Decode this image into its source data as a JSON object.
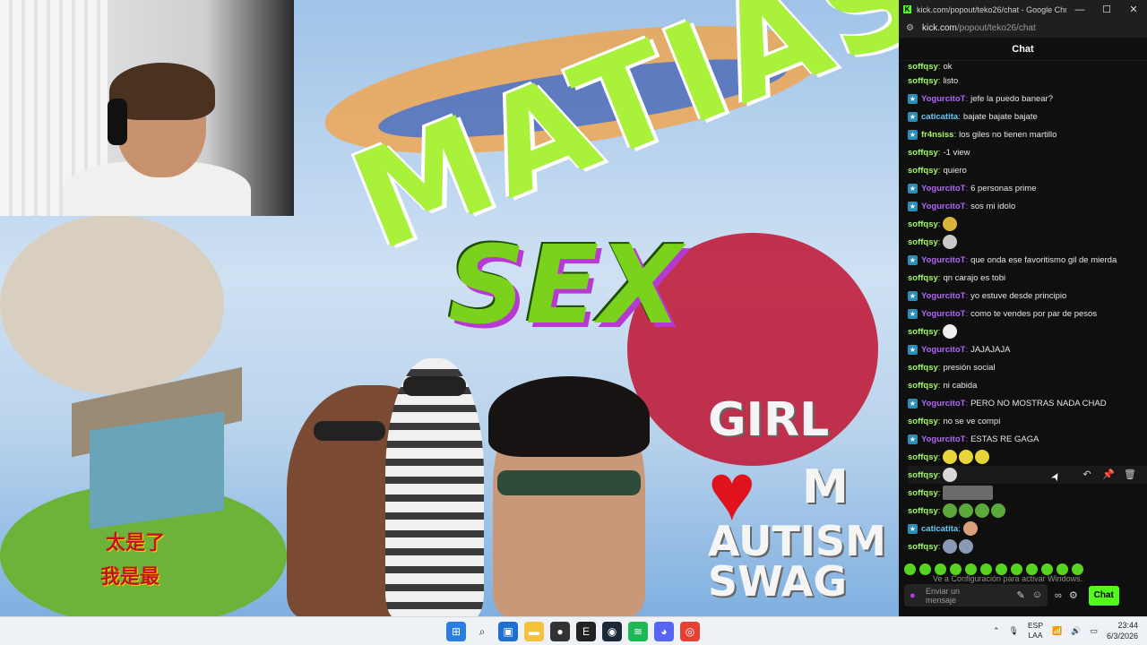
{
  "browser": {
    "title": "kick.com/popout/teko26/chat - Google Chro...",
    "url_host": "kick.com",
    "url_path": "/popout/teko26/chat",
    "minimize": "—",
    "maximize": "☐",
    "close": "✕"
  },
  "chat": {
    "header": "Chat",
    "messages": [
      {
        "user": "soffqsy",
        "color": "#a4f56b",
        "badge": false,
        "text": "ok"
      },
      {
        "user": "soffqsy",
        "color": "#a4f56b",
        "badge": false,
        "text": "listo"
      },
      {
        "user": "YogurcitoT",
        "color": "#b067f7",
        "badge": true,
        "text": "jefe la puedo banear?"
      },
      {
        "user": "caticatita",
        "color": "#69c9f7",
        "badge": true,
        "text": "bajate bajate bajate"
      },
      {
        "user": "fr4nsiss",
        "color": "#a4f56b",
        "badge": true,
        "text": "los giles no tienen martillo"
      },
      {
        "user": "soffqsy",
        "color": "#a4f56b",
        "badge": false,
        "text": "-1 view"
      },
      {
        "user": "soffqsy",
        "color": "#a4f56b",
        "badge": false,
        "text": "quiero"
      },
      {
        "user": "YogurcitoT",
        "color": "#b067f7",
        "badge": true,
        "text": "6 personas prime"
      },
      {
        "user": "YogurcitoT",
        "color": "#b067f7",
        "badge": true,
        "text": "sos mi idolo"
      },
      {
        "user": "soffqsy",
        "color": "#a4f56b",
        "badge": false,
        "text": "",
        "emotes": [
          "#d9b23a"
        ]
      },
      {
        "user": "soffqsy",
        "color": "#a4f56b",
        "badge": false,
        "text": "",
        "emotes": [
          "#c9c9c9"
        ]
      },
      {
        "user": "YogurcitoT",
        "color": "#b067f7",
        "badge": true,
        "text": "que onda ese favoritismo gil de mierda"
      },
      {
        "user": "soffqsy",
        "color": "#a4f56b",
        "badge": false,
        "text": "qn carajo es tobi"
      },
      {
        "user": "YogurcitoT",
        "color": "#b067f7",
        "badge": true,
        "text": "yo estuve desde principio"
      },
      {
        "user": "YogurcitoT",
        "color": "#b067f7",
        "badge": true,
        "text": "como te vendes por par de pesos"
      },
      {
        "user": "soffqsy",
        "color": "#a4f56b",
        "badge": false,
        "text": "",
        "emotes": [
          "#eeeeee"
        ]
      },
      {
        "user": "YogurcitoT",
        "color": "#b067f7",
        "badge": true,
        "text": "JAJAJAJA"
      },
      {
        "user": "soffqsy",
        "color": "#a4f56b",
        "badge": false,
        "text": "presión social"
      },
      {
        "user": "soffqsy",
        "color": "#a4f56b",
        "badge": false,
        "text": "ni cabida"
      },
      {
        "user": "YogurcitoT",
        "color": "#b067f7",
        "badge": true,
        "text": "PERO NO MOSTRAS NADA CHAD"
      },
      {
        "user": "soffqsy",
        "color": "#a4f56b",
        "badge": false,
        "text": "no se ve compi"
      },
      {
        "user": "YogurcitoT",
        "color": "#b067f7",
        "badge": true,
        "text": "ESTAS RE GAGA"
      },
      {
        "user": "soffqsy",
        "color": "#a4f56b",
        "badge": false,
        "text": "",
        "emotes": [
          "#e6d43a",
          "#e6d43a",
          "#e6d43a"
        ]
      },
      {
        "user": "soffqsy",
        "color": "#a4f56b",
        "badge": false,
        "text": "",
        "emotes": [
          "#d8d8d8"
        ],
        "hovered": true
      },
      {
        "user": "soffqsy",
        "color": "#a4f56b",
        "badge": false,
        "text": "",
        "wide_emote": "#6b6b6b"
      },
      {
        "user": "soffqsy",
        "color": "#a4f56b",
        "badge": false,
        "text": "",
        "emotes": [
          "#5da83a",
          "#5da83a",
          "#5da83a",
          "#5da83a"
        ]
      },
      {
        "user": "caticatita",
        "color": "#69c9f7",
        "badge": true,
        "text": "",
        "emotes": [
          "#d8a07a"
        ]
      },
      {
        "user": "soffqsy",
        "color": "#a4f56b",
        "badge": false,
        "text": "",
        "emotes": [
          "#8a9ab5",
          "#8a9ab5"
        ]
      }
    ],
    "hover_tools": [
      "↶",
      "📌",
      "🗑"
    ],
    "watermark": "Ve a Configuración para activar Windows.",
    "input_placeholder": "Enviar un mensaje",
    "send_label": "Chat"
  },
  "overlay": {
    "title": "MATIAS",
    "sub": "SEX",
    "side_line1": "GIRL",
    "side_line2": "M",
    "side_line3": "AUTISM",
    "side_line4": "SWAG",
    "jp1": "太是了",
    "jp2": "我是最"
  },
  "taskbar": {
    "lang1": "ESP",
    "lang2": "LAA",
    "time": "23:44",
    "date": "6/3/2026"
  }
}
